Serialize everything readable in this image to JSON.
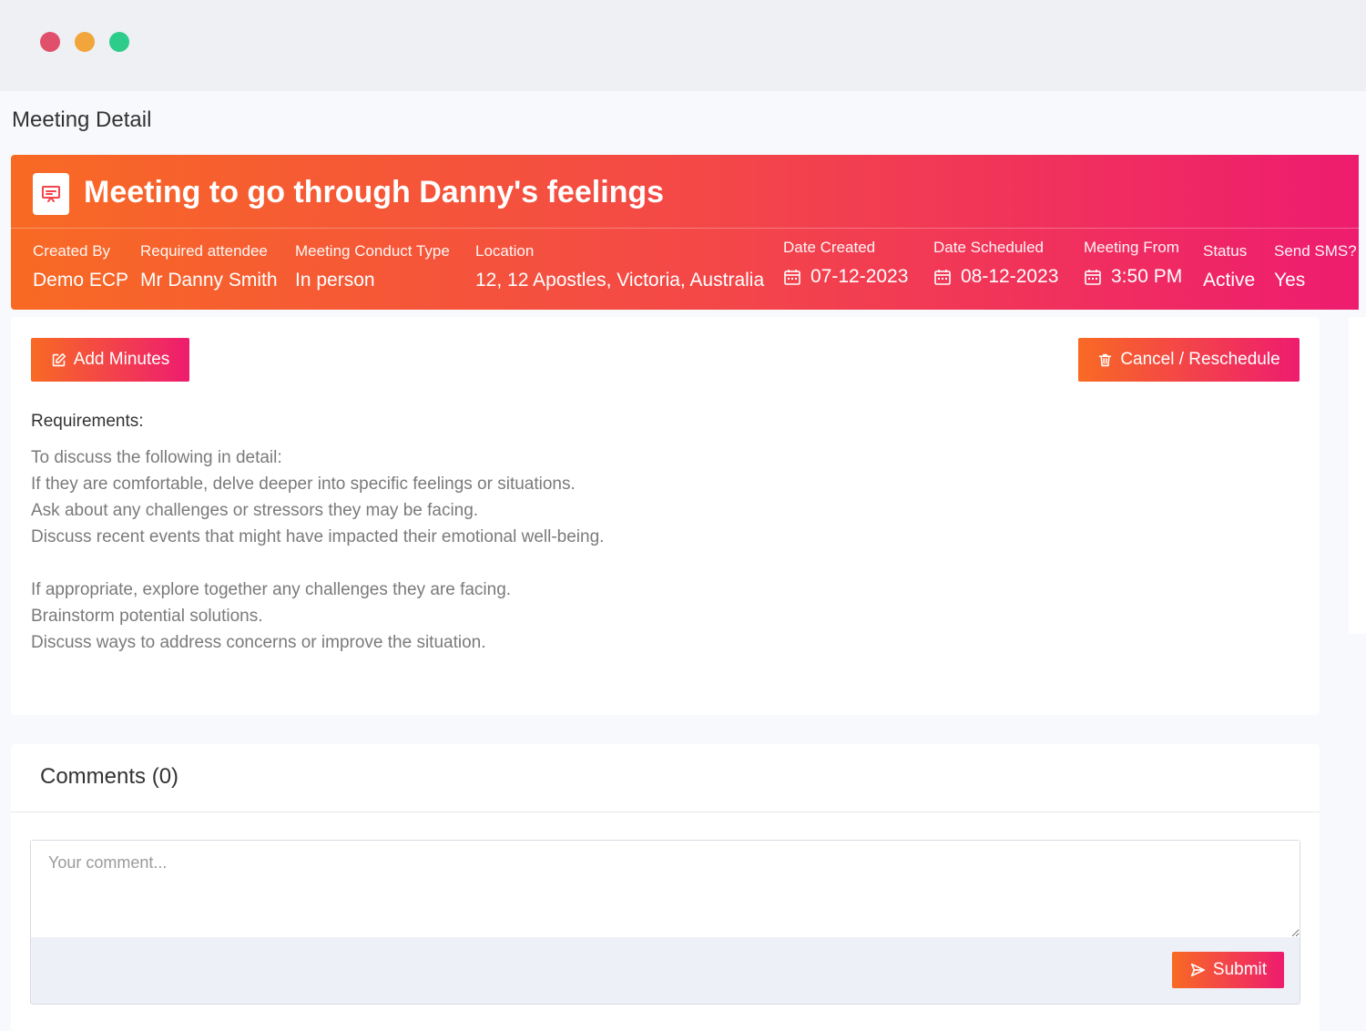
{
  "page": {
    "title": "Meeting Detail"
  },
  "meeting": {
    "title": "Meeting to go through Danny's feelings",
    "fields": [
      {
        "label": "Created By",
        "value": "Demo ECP"
      },
      {
        "label": "Required attendee",
        "value": "Mr Danny Smith"
      },
      {
        "label": "Meeting Conduct Type",
        "value": "In person"
      },
      {
        "label": "Location",
        "value": "12, 12 Apostles, Victoria, Australia"
      },
      {
        "label": "Date Created",
        "value": "07-12-2023",
        "icon": "calendar-icon"
      },
      {
        "label": "Date Scheduled",
        "value": "08-12-2023",
        "icon": "calendar-icon"
      },
      {
        "label": "Meeting From",
        "value": "3:50 PM",
        "icon": "calendar-icon"
      },
      {
        "label": "Status",
        "value": "Active"
      },
      {
        "label": "Send SMS?",
        "value": "Yes"
      }
    ]
  },
  "actions": {
    "add_minutes": "Add Minutes",
    "cancel_reschedule": "Cancel / Reschedule"
  },
  "requirements": {
    "heading": "Requirements:",
    "lines": [
      "To discuss the following in detail:",
      "If they are comfortable, delve deeper into specific feelings or situations.",
      "Ask about any challenges or stressors they may be facing.",
      "Discuss recent events that might have impacted their emotional well-being.",
      "",
      "If appropriate, explore together any challenges they are facing.",
      "Brainstorm potential solutions.",
      "Discuss ways to address concerns or improve the situation."
    ]
  },
  "comments": {
    "heading": "Comments (0)",
    "placeholder": "Your comment...",
    "submit_label": "Submit"
  },
  "colors": {
    "gradient_start": "#f86a24",
    "gradient_end": "#ee1c6f",
    "traffic_red": "#e0506b",
    "traffic_yellow": "#f2a53a",
    "traffic_green": "#2ecc8a"
  }
}
